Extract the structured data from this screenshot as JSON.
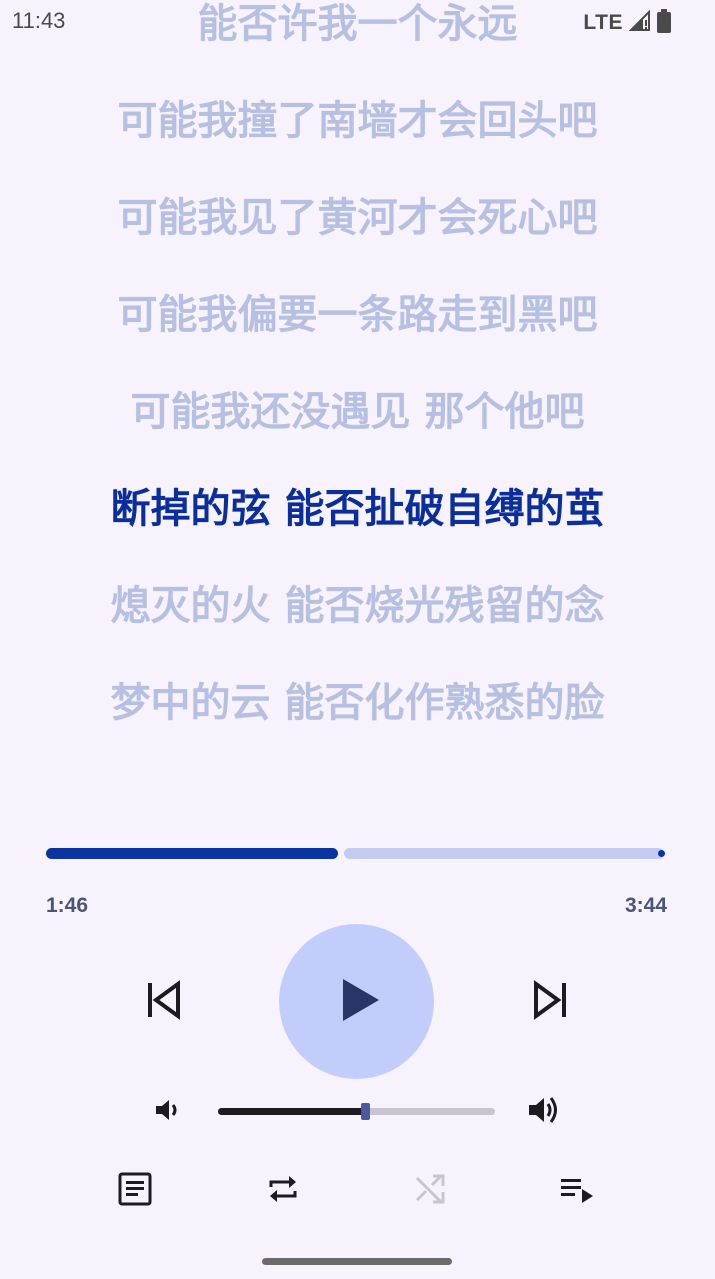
{
  "status_bar": {
    "time": "11:43",
    "network": "LTE"
  },
  "lyrics": {
    "lines": [
      "能否许我一个永远",
      "可能我撞了南墙才会回头吧",
      "可能我见了黄河才会死心吧",
      "可能我偏要一条路走到黑吧",
      "可能我还没遇见 那个他吧",
      "断掉的弦 能否扯破自缚的茧",
      "熄灭的火 能否烧光残留的念",
      "梦中的云 能否化作熟悉的脸"
    ],
    "current_index": 5
  },
  "playback": {
    "elapsed": "1:46",
    "duration": "3:44",
    "progress_fraction": 0.473
  },
  "volume": {
    "level_fraction": 0.53
  },
  "icons": {
    "previous": "skip-previous-icon",
    "play": "play-icon",
    "next": "skip-next-icon",
    "volume_down": "volume-down-icon",
    "volume_up": "volume-up-icon",
    "lyrics": "lyrics-icon",
    "repeat": "repeat-icon",
    "shuffle": "shuffle-icon",
    "queue": "queue-icon"
  },
  "colors": {
    "background": "#f7f2fb",
    "lyric_inactive": "#b6c0e3",
    "lyric_active": "#0a2e9c",
    "progress_played": "#0a34a0",
    "progress_remaining": "#c3cbf1",
    "play_button_bg": "#c3cdfc",
    "shuffle_disabled": "#c9c5d0"
  }
}
